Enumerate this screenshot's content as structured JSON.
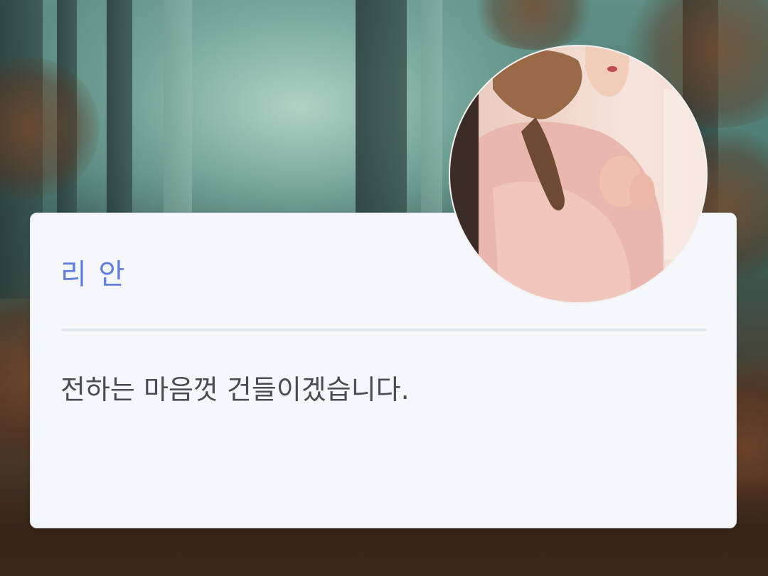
{
  "profile": {
    "name": "리 안",
    "message": "전하는 마음껏 건들이겠습니다."
  },
  "colors": {
    "name_accent": "#5e7fe0",
    "card_background": "#f5f7fa",
    "message_text": "#494d52"
  },
  "icons": {
    "avatar": "profile-photo"
  }
}
